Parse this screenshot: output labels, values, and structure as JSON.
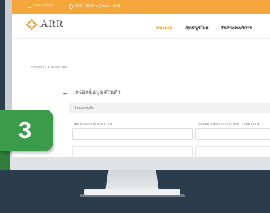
{
  "topbar": {
    "phone": "02-4750599",
    "hours": "9:00 - 16:30 น. (จันทร์ - ศุกร์)"
  },
  "header": {
    "logo_text": "ARR",
    "logo_sub": "LEASE TRADING",
    "nav": [
      {
        "label": "หน้าแรก",
        "active": true
      },
      {
        "label": "เปิดบัญชีใหม่",
        "active": false
      },
      {
        "label": "สินค้าและบริการ",
        "active": false
      }
    ]
  },
  "breadcrumb": "หน้าแรก / สมัครสมาชิก",
  "form": {
    "title": "กรอกข้อมูลส่วนตัว",
    "section": "ข้อมูลส่วนตัว",
    "fields": [
      {
        "label": "เลขบัตรประจำตัวประชาชน"
      },
      {
        "label": "วันหมดอายุบัตรประชาชน (ค.ศ. วว/ดด/ปปปป)"
      }
    ]
  },
  "step_badge": "3",
  "colors": {
    "accent": "#f4a63a",
    "badge": "#3b9c4b",
    "background": "#2b3d4c"
  }
}
